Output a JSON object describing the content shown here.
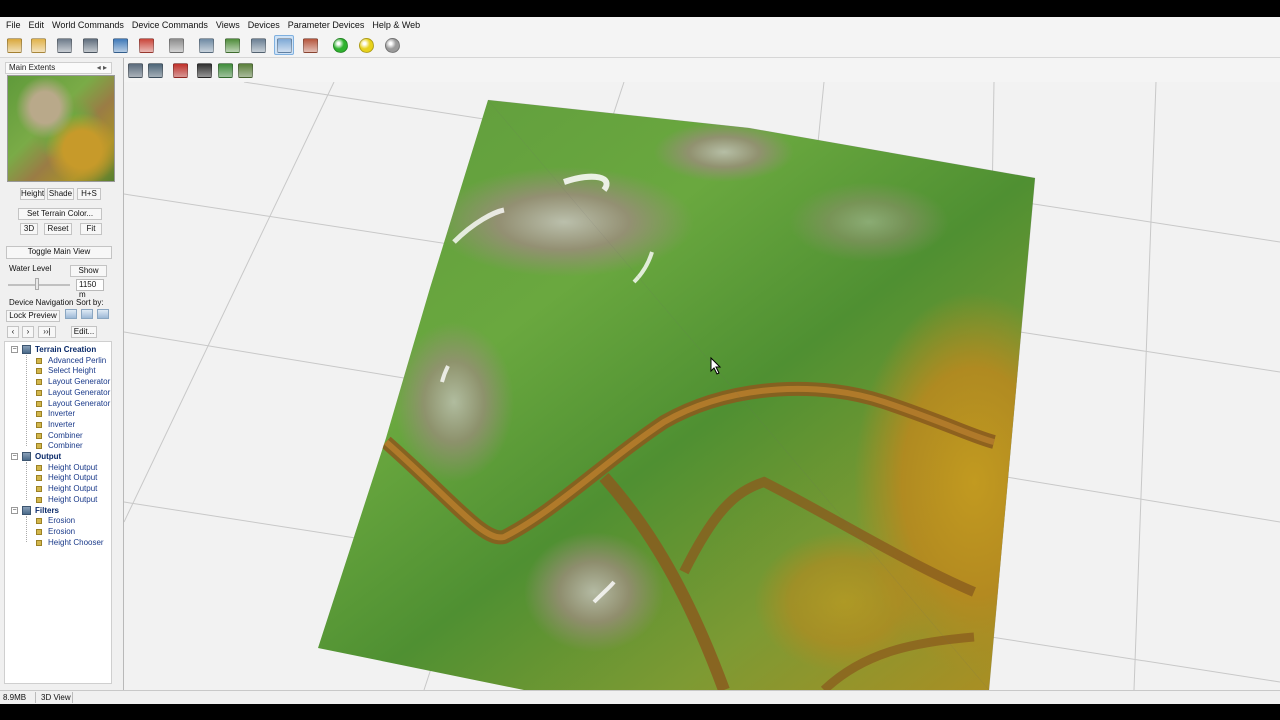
{
  "menu": [
    "File",
    "Edit",
    "World Commands",
    "Device Commands",
    "Views",
    "Devices",
    "Parameter Devices",
    "Help & Web"
  ],
  "toolbar_icons": [
    {
      "name": "new-world-icon",
      "color": "#d9a83c"
    },
    {
      "name": "open-world-icon",
      "color": "#e0b24a"
    },
    {
      "name": "save-world-icon",
      "color": "#6e7b8a"
    },
    {
      "name": "properties-icon",
      "color": "#5f6d7c"
    },
    {
      "name": "import-icon",
      "color": "#3f79b8"
    },
    {
      "name": "export-icon",
      "color": "#c9453a"
    },
    {
      "name": "world-settings-icon",
      "color": "#8c8c8c"
    },
    {
      "name": "film-strip-icon",
      "color": "#6f8aa3"
    },
    {
      "name": "grid-view-icon",
      "color": "#4e8c3a"
    },
    {
      "name": "globe-icon",
      "color": "#6a7f93"
    },
    {
      "name": "terrain-3d-icon",
      "color": "#7fa9d6"
    },
    {
      "name": "render-icon",
      "color": "#b5553c"
    },
    {
      "name": "build-green-icon",
      "color": "#2fb22f"
    },
    {
      "name": "build-yellow-icon",
      "color": "#e8d21c"
    },
    {
      "name": "stop-grey-icon",
      "color": "#9a9a9a"
    }
  ],
  "toolbar2_icons": [
    {
      "name": "camera-mode-icon",
      "color": "#5b6b7c"
    },
    {
      "name": "fly-mode-icon",
      "color": "#4d6578"
    },
    {
      "name": "record-icon",
      "color": "#c0302a"
    },
    {
      "name": "lighting-icon",
      "color": "#2f2f2f"
    },
    {
      "name": "texture-icon",
      "color": "#3f8c3a"
    },
    {
      "name": "help-icon",
      "color": "#5a7f3a"
    }
  ],
  "left_panel": {
    "title": "Main Extents",
    "title_arrows": "◂ ▸",
    "tabs": [
      "Height",
      "Shade",
      "H+S"
    ],
    "set_color_label": "Set Terrain Color...",
    "view_buttons": [
      "3D",
      "Reset",
      "Fit"
    ],
    "toggle_main_view": "Toggle Main View",
    "water_level_label": "Water Level",
    "water_show": "Show",
    "water_value": "1150 m",
    "water_level_fraction": 0.47,
    "device_navigation_label": "Device Navigation",
    "sort_by_label": "Sort by:",
    "lock_preview": "Lock Preview",
    "nav_buttons": [
      "‹",
      "›",
      "››|"
    ],
    "edit_button": "Edit...",
    "tree": [
      {
        "category": "Terrain Creation",
        "items": [
          "Advanced Perlin",
          "Select Height",
          "Layout Generator",
          "Layout Generator",
          "Layout Generator",
          "Inverter",
          "Inverter",
          "Combiner",
          "Combiner"
        ]
      },
      {
        "category": "Output",
        "items": [
          "Height Output",
          "Height Output",
          "Height Output",
          "Height Output"
        ]
      },
      {
        "category": "Filters",
        "items": [
          "Erosion",
          "Erosion",
          "Height Chooser"
        ]
      }
    ]
  },
  "status": {
    "memory": "8.9MB",
    "view": "3D View"
  }
}
